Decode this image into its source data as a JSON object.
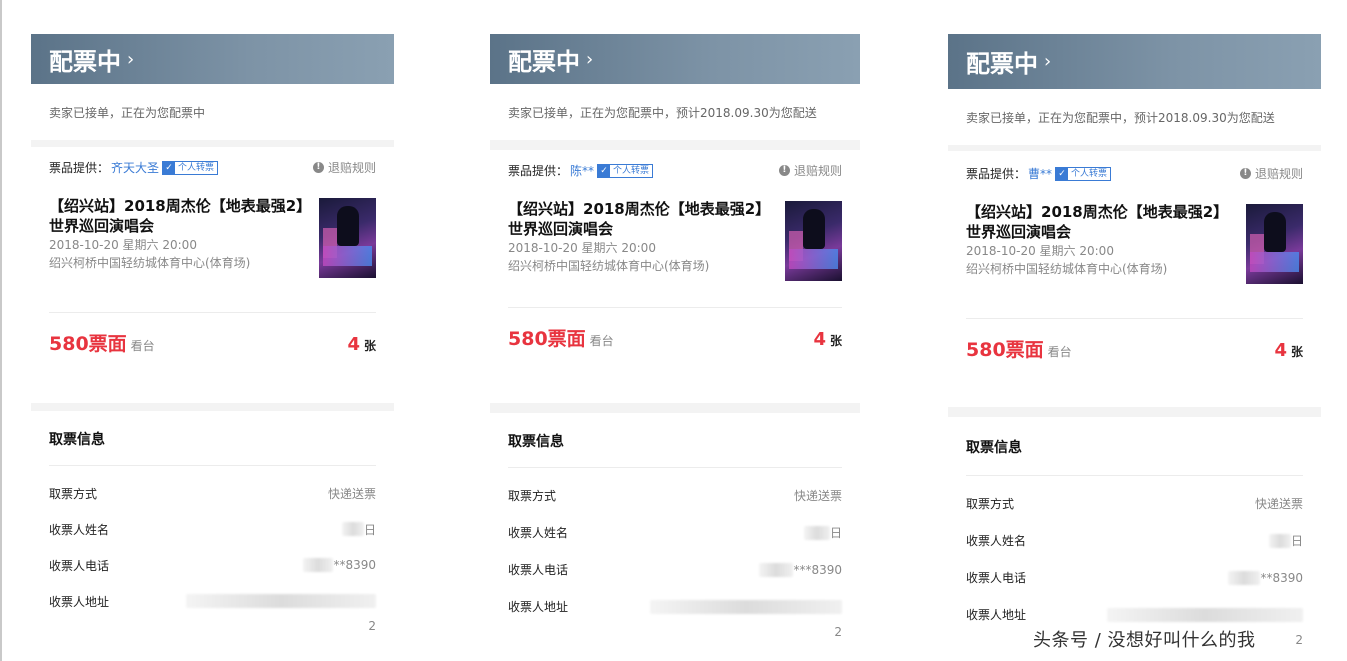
{
  "panels": [
    {
      "header": "配票中",
      "subtitle": "卖家已接单，正在为您配票中",
      "provider_label": "票品提供：",
      "seller": "齐天大圣",
      "badge": "个人转票",
      "refund": "退赔规则",
      "show_title": "【绍兴站】2018周杰伦【地表最强2】世界巡回演唱会",
      "show_date": "2018-10-20 星期六 20:00",
      "show_venue": "绍兴柯桥中国轻纺城体育中心(体育场)",
      "price": "580票面",
      "stand": "看台",
      "count": "4",
      "count_unit": "张",
      "pick_title": "取票信息",
      "rows": [
        {
          "label": "取票方式",
          "value": "快递送票"
        },
        {
          "label": "收票人姓名",
          "value": "日"
        },
        {
          "label": "收票人电话",
          "value": "**8390"
        },
        {
          "label": "收票人地址",
          "value": "2"
        }
      ]
    },
    {
      "header": "配票中",
      "subtitle": "卖家已接单，正在为您配票中，预计2018.09.30为您配送",
      "provider_label": "票品提供：",
      "seller": "陈**",
      "badge": "个人转票",
      "refund": "退赔规则",
      "show_title": "【绍兴站】2018周杰伦【地表最强2】世界巡回演唱会",
      "show_date": "2018-10-20 星期六 20:00",
      "show_venue": "绍兴柯桥中国轻纺城体育中心(体育场)",
      "price": "580票面",
      "stand": "看台",
      "count": "4",
      "count_unit": "张",
      "pick_title": "取票信息",
      "rows": [
        {
          "label": "取票方式",
          "value": "快递送票"
        },
        {
          "label": "收票人姓名",
          "value": "日"
        },
        {
          "label": "收票人电话",
          "value": "***8390"
        },
        {
          "label": "收票人地址",
          "value": "2"
        }
      ]
    },
    {
      "header": "配票中",
      "subtitle": "卖家已接单，正在为您配票中，预计2018.09.30为您配送",
      "provider_label": "票品提供：",
      "seller": "曹**",
      "badge": "个人转票",
      "refund": "退赔规则",
      "show_title": "【绍兴站】2018周杰伦【地表最强2】世界巡回演唱会",
      "show_date": "2018-10-20 星期六 20:00",
      "show_venue": "绍兴柯桥中国轻纺城体育中心(体育场)",
      "price": "580票面",
      "stand": "看台",
      "count": "4",
      "count_unit": "张",
      "pick_title": "取票信息",
      "rows": [
        {
          "label": "取票方式",
          "value": "快递送票"
        },
        {
          "label": "收票人姓名",
          "value": "日"
        },
        {
          "label": "收票人电话",
          "value": "**8390"
        },
        {
          "label": "收票人地址",
          "value": "2"
        }
      ]
    }
  ],
  "watermark": "头条号 / 没想好叫什么的我",
  "colors": {
    "header": "#6b8297",
    "accent": "#e8343f",
    "link": "#3a7bd5"
  },
  "icons": {
    "chevron": "chevron-right-icon",
    "check": "check-icon",
    "info": "info-icon"
  }
}
